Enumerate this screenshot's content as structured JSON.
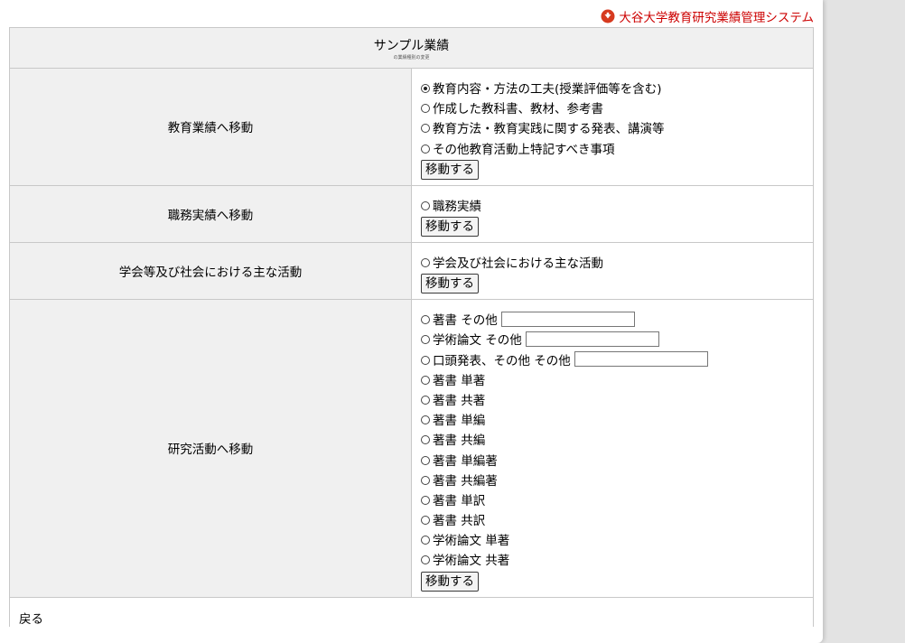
{
  "brand": {
    "name": "大谷大学教育研究業績管理システム",
    "color": "#cc0000"
  },
  "header": {
    "title": "サンプル業績",
    "subtitle": "の業績種別の変更"
  },
  "sections": [
    {
      "label": "教育業績へ移動",
      "options": [
        {
          "text": "教育内容・方法の工夫(授業評価等を含む)",
          "checked": true
        },
        {
          "text": "作成した教科書、教材、参考書"
        },
        {
          "text": "教育方法・教育実践に関する発表、講演等"
        },
        {
          "text": "その他教育活動上特記すべき事項"
        }
      ],
      "button": "移動する"
    },
    {
      "label": "職務実績へ移動",
      "options": [
        {
          "text": "職務実績"
        }
      ],
      "button": "移動する"
    },
    {
      "label": "学会等及び社会における主な活動",
      "options": [
        {
          "text": "学会及び社会における主な活動"
        }
      ],
      "button": "移動する"
    },
    {
      "label": "研究活動へ移動",
      "options": [
        {
          "text": "著書 その他",
          "has_input": true,
          "input_value": ""
        },
        {
          "text": "学術論文 その他",
          "has_input": true,
          "input_value": ""
        },
        {
          "text": "口頭発表、その他 その他",
          "has_input": true,
          "input_value": ""
        },
        {
          "text": "著書 単著"
        },
        {
          "text": "著書 共著"
        },
        {
          "text": "著書 単編"
        },
        {
          "text": "著書 共編"
        },
        {
          "text": "著書 単編著"
        },
        {
          "text": "著書 共編著"
        },
        {
          "text": "著書 単訳"
        },
        {
          "text": "著書 共訳"
        },
        {
          "text": "学術論文 単著"
        },
        {
          "text": "学術論文 共著"
        }
      ],
      "button": "移動する"
    }
  ],
  "footer": {
    "back": "戻る"
  }
}
